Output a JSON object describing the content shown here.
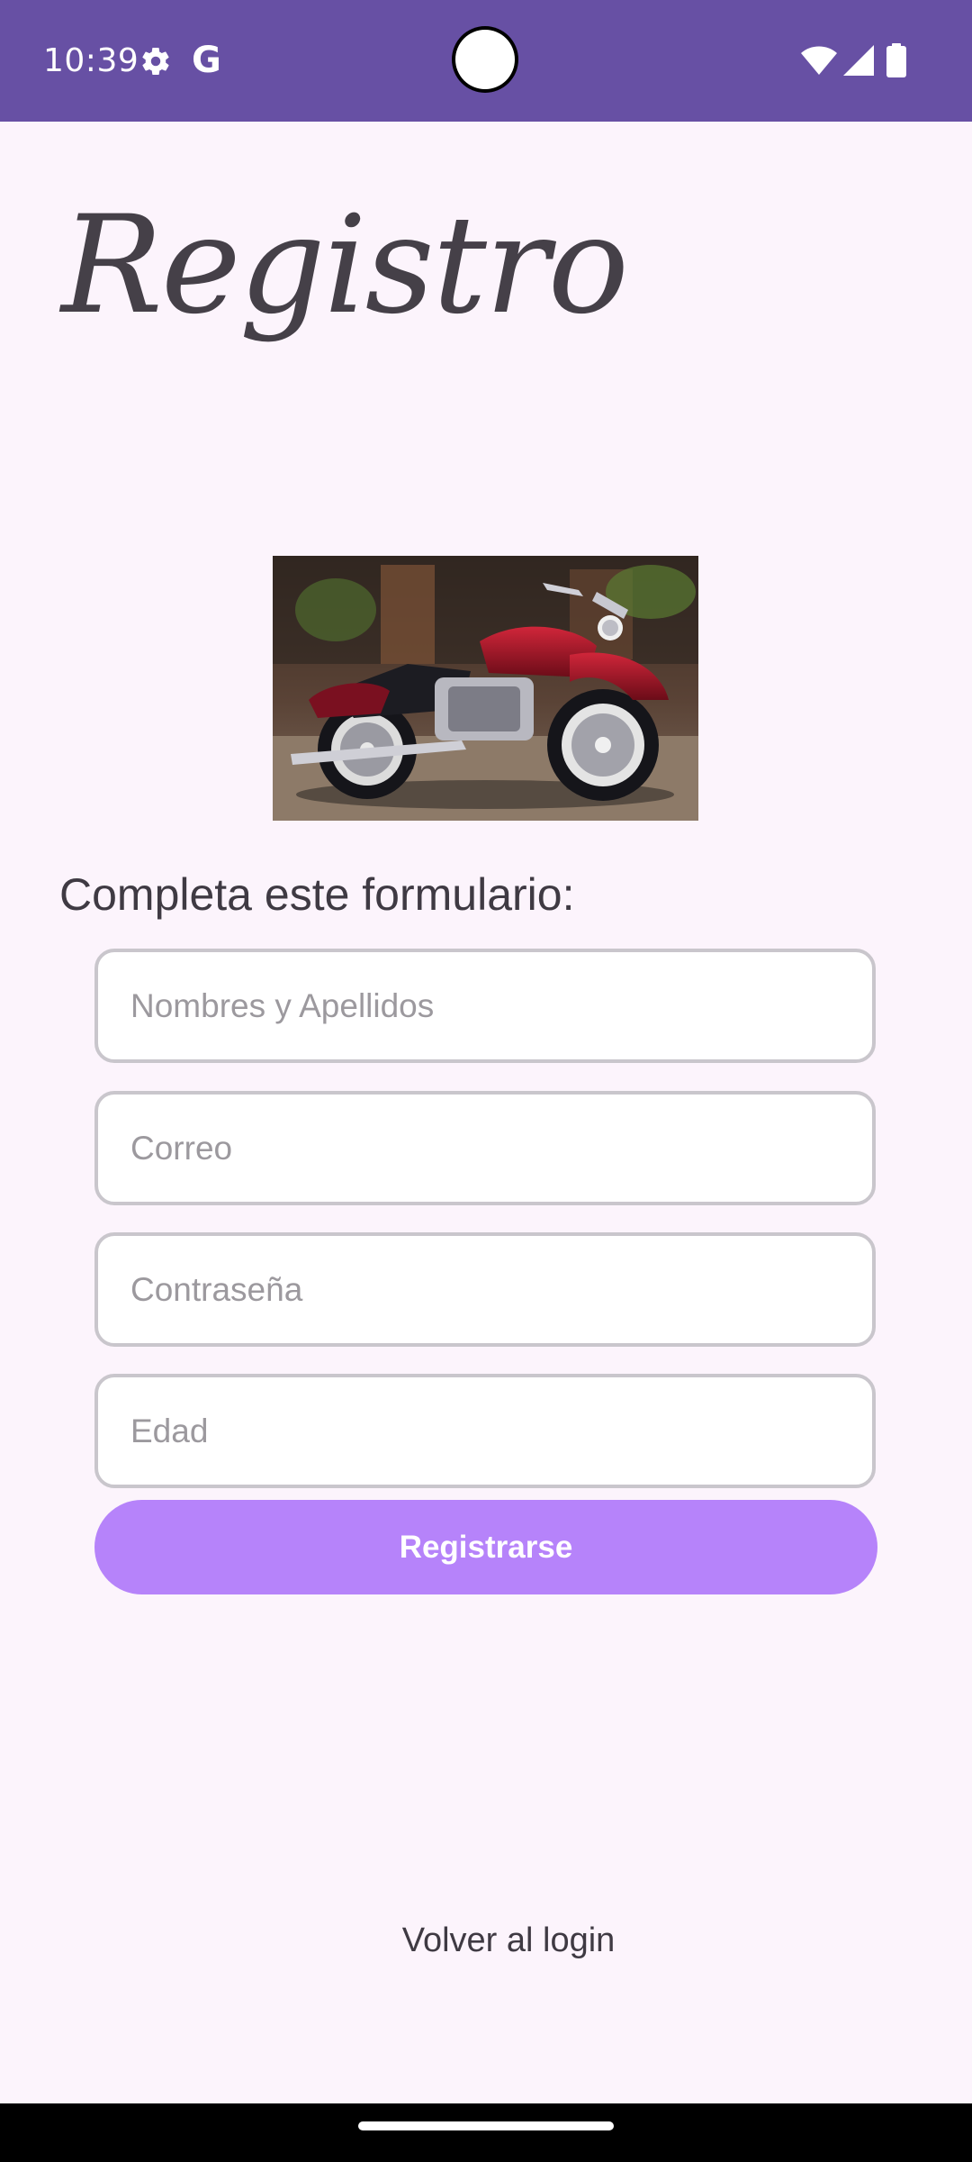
{
  "status_bar": {
    "time": "10:39",
    "g_label": "G",
    "icons": [
      "gear-icon",
      "google-g-icon",
      "wifi-icon",
      "cell-signal-icon",
      "battery-icon"
    ]
  },
  "title": "Registro",
  "image": {
    "subject": "motorcycle-photo"
  },
  "form": {
    "heading": "Completa este formulario:",
    "fields": [
      {
        "placeholder": "Nombres y Apellidos",
        "value": ""
      },
      {
        "placeholder": "Correo",
        "value": ""
      },
      {
        "placeholder": "Contraseña",
        "value": ""
      },
      {
        "placeholder": "Edad",
        "value": ""
      }
    ],
    "submit_label": "Registrarse"
  },
  "back_link": "Volver al login",
  "colors": {
    "status_bar": "#6750a4",
    "background": "#fcf4fc",
    "button": "#b683fa",
    "field_border": "#c9c6cc",
    "text": "#3f3a43"
  }
}
